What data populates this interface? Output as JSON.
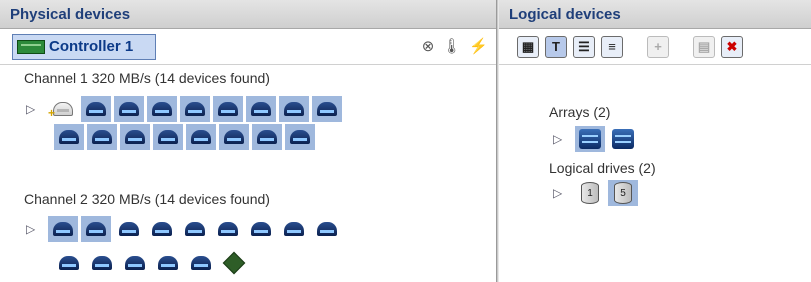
{
  "physical": {
    "title": "Physical devices",
    "controller_label": "Controller 1",
    "channels": [
      {
        "label": "Channel 1  320 MB/s (14 devices found)",
        "devices": 15
      },
      {
        "label": "Channel 2  320 MB/s (14 devices found)",
        "devices": 15
      }
    ]
  },
  "logical": {
    "title": "Logical devices",
    "arrays_label": "Arrays (2)",
    "drives_label": "Logical drives (2)",
    "drive_numbers": [
      "1",
      "5"
    ],
    "toolbar_text_icon": "T"
  },
  "colors": {
    "header_text": "#1f3f7a",
    "selection": "#9fb8dd"
  }
}
